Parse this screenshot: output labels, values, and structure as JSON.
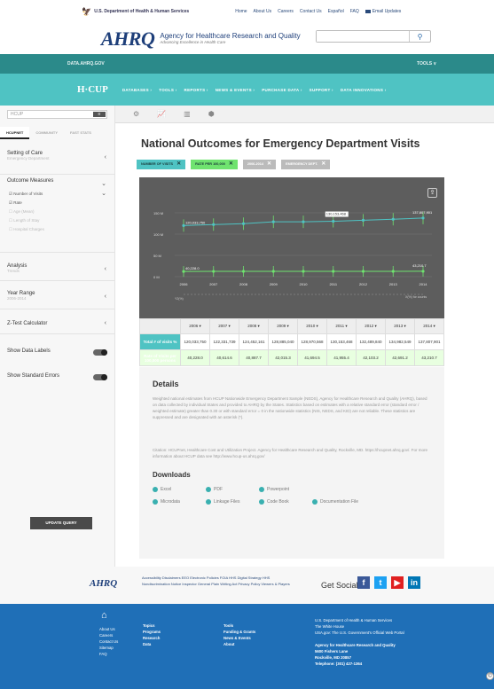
{
  "topbar": {
    "hhs": "U.S. Department of Health & Human Services",
    "links": [
      "Home",
      "About Us",
      "Careers",
      "Contact Us",
      "Español",
      "FAQ"
    ],
    "email": "Email Updates"
  },
  "header": {
    "logo": "AHRQ",
    "agency": "Agency for Healthcare Research and Quality",
    "tagline": "Advancing Excellence in Health Care",
    "search_placeholder": ""
  },
  "darknav": {
    "site": "DATA.AHRQ.GOV",
    "tools": "TOOLS ∨"
  },
  "hcupnav": {
    "brand": "H·CUP",
    "items": [
      "DATABASES ›",
      "TOOLS ›",
      "REPORTS ›",
      "NEWS & EVENTS ›",
      "PURCHASE DATA ›",
      "SUPPORT ›",
      "DATA INNOVATIONS ›"
    ]
  },
  "sidebar": {
    "select_value": "HCUP",
    "tabs": [
      "HCUPNET",
      "COMMUNITY",
      "FAST STATS"
    ],
    "setting_title": "Setting of Care",
    "setting_sub": "Emergency Department",
    "outcome_title": "Outcome Measures",
    "outcome_options": [
      "Number of Visits",
      "Rate",
      "Age (Mean)",
      "Length of Stay",
      "Hospital Charges"
    ],
    "analysis_title": "Analysis",
    "analysis_sub": "Trends",
    "year_title": "Year Range",
    "year_sub": "2006-2014",
    "ztest": "Z-Test Calculator",
    "show_labels": "Show Data Labels",
    "show_errors": "Show Standard Errors",
    "update": "UPDATE QUERY"
  },
  "main": {
    "title": "National Outcomes for Emergency Department Visits",
    "chips": [
      {
        "label": "NUMBER OF VISITS",
        "color": "#4fc3c3"
      },
      {
        "label": "RATE PER 100,000",
        "color": "#6fe36f"
      },
      {
        "label": "2006-2014",
        "color": "#bbbbbb"
      },
      {
        "label": "EMERGENCY DEPT.",
        "color": "#bbbbbb"
      }
    ],
    "table": {
      "years": [
        "2006",
        "2007",
        "2008",
        "2009",
        "2010",
        "2011",
        "2012",
        "2013",
        "2014"
      ],
      "row1_label": "Total # of visits %",
      "row1": [
        "120,033,750",
        "122,331,739",
        "124,452,161",
        "128,885,040",
        "128,970,568",
        "130,153,468",
        "132,489,840",
        "134,982,549",
        "137,807,901"
      ],
      "row2_label": "Rate of Visits per 100,000 persons",
      "row2": [
        "40,228.0",
        "40,614.6",
        "40,887.7",
        "42,015.3",
        "41,694.5",
        "41,955.4",
        "42,103.2",
        "42,691.2",
        "43,210.7"
      ]
    },
    "details_title": "Details",
    "details_p1": "Weighted national estimates from HCUP Nationwide Emergency Department Sample (NEDS), Agency for Healthcare Research and Quality (AHRQ), based on data collected by individual States and provided to AHRQ by the States. Statistics based on estimates with a relative standard error (standard error / weighted estimate) greater than 0.30 or with standard error = 0 in the nationwide statistics (NIS, NEDS, and KID) are not reliable. These statistics are suppressed and are designated with an asterisk (*).",
    "details_p2": "Citation: HCUPnet, Healthcare Cost and Utilization Project. Agency for Healthcare Research and Quality, Rockville, MD. https://hcupnet.ahrq.gov/. For more information about HCUP data see http://www.hcup-us.ahrq.gov/",
    "downloads_title": "Downloads",
    "downloads": [
      "Excel",
      "PDF",
      "Powerpoint",
      "Microdata",
      "Linkage Files",
      "Code Book",
      "Documentation File"
    ]
  },
  "chart_data": {
    "type": "line",
    "x": [
      "2006",
      "2007",
      "2008",
      "2009",
      "2010",
      "2011",
      "2012",
      "2013",
      "2014"
    ],
    "series": [
      {
        "values": [
          120033750,
          122331739,
          124452161,
          128885040,
          128970568,
          130153468,
          132489840,
          134982549,
          137807901
        ],
        "color": "#4fc3c3"
      },
      {
        "values": [
          40228.0,
          40614.6,
          40887.7,
          42015.3,
          41694.5,
          41955.4,
          42103.2,
          42691.2,
          43210.7
        ],
        "color": "#6fe36f"
      }
    ],
    "point_labels": [
      "120,033,750",
      "130,153,468",
      "137,807,901",
      "40,228.0",
      "43,210.7"
    ],
    "y_ticks": [
      "150 M",
      "100 M",
      "50 M",
      "0 M"
    ],
    "x_extra_labels": [
      "Y2(%)",
      "X(%) for counts"
    ],
    "title": "",
    "xlabel": "",
    "ylabel": ""
  },
  "footer": {
    "logo": "AHRQ",
    "links": "Accessibility  Disclaimers  EEO  Electronic Policies  FOIA  HHS Digital Strategy  HHS Nondiscrimination Notice  Inspector General  Plain Writing Act  Privacy Policy  Viewers & Players",
    "social": "Get Social",
    "col1": [
      "About Us",
      "Careers",
      "Contact Us",
      "Sitemap",
      "FAQ"
    ],
    "col2": [
      "Topics",
      "Programs",
      "Research",
      "Data"
    ],
    "col3": [
      "Tools",
      "Funding & Grants",
      "News & Events",
      "About"
    ],
    "col4": [
      "U.S. Department of Health & Human Services",
      "The White House",
      "USA.gov: The U.S. Government's Official Web Portal"
    ],
    "col4b": [
      "Agency for Healthcare Research and Quality",
      "5600 Fishers Lane",
      "Rockville, MD 20857",
      "Telephone: (301) 427-1364"
    ]
  }
}
